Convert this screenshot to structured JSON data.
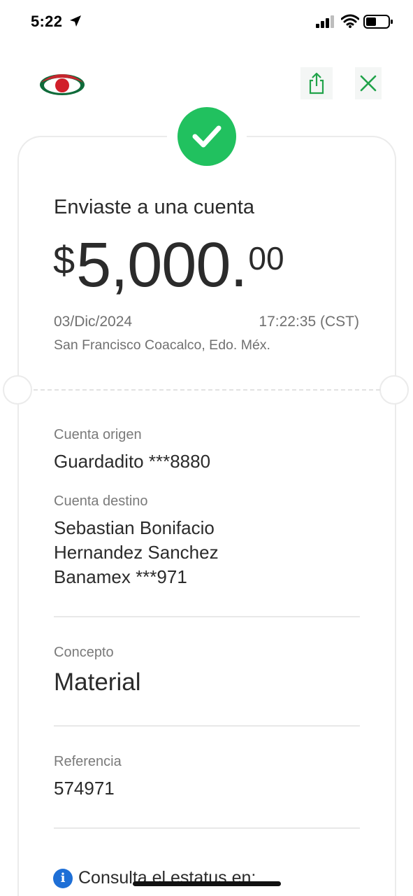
{
  "status_bar": {
    "time": "5:22",
    "icons": [
      "location-arrow-icon",
      "cellular-signal-icon",
      "wifi-icon",
      "battery-icon"
    ]
  },
  "header": {
    "logo": "bank-logo",
    "share_icon": "share-icon",
    "close_icon": "close-icon",
    "accent_color": "#21a34a"
  },
  "receipt": {
    "status_icon": "check-icon",
    "status_color": "#21c15f",
    "title": "Enviaste a una cuenta",
    "amount": {
      "currency": "$",
      "integer": "5,000.",
      "decimals": "00"
    },
    "date": "03/Dic/2024",
    "time": "17:22:35 (CST)",
    "location": "San Francisco Coacalco, Edo. Méx."
  },
  "details": {
    "origin_label": "Cuenta origen",
    "origin_value": "Guardadito ***8880",
    "destination_label": "Cuenta destino",
    "destination_lines": [
      "Sebastian Bonifacio",
      "Hernandez Sanchez",
      "Banamex ***971"
    ],
    "concept_label": "Concepto",
    "concept_value": "Material",
    "reference_label": "Referencia",
    "reference_value": "574971"
  },
  "footer": {
    "info_icon": "info-icon",
    "info_icon_glyph": "i",
    "info_text": "Consulta el estatus en:"
  }
}
